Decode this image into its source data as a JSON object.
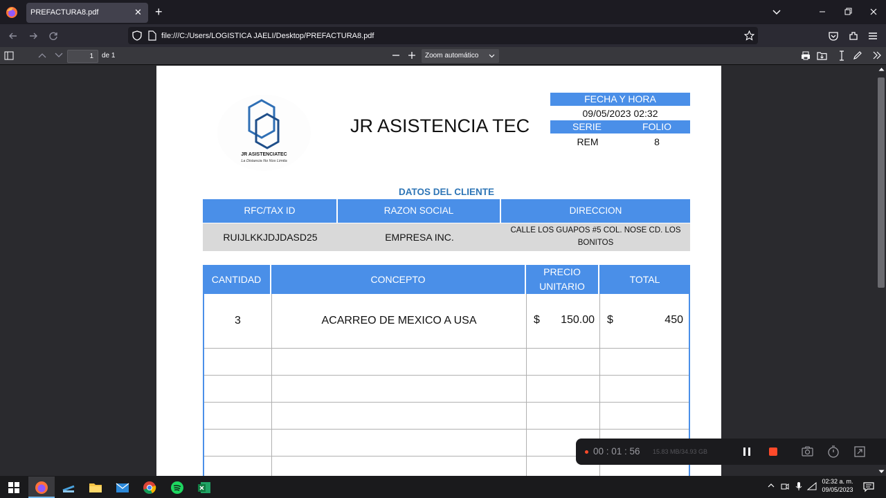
{
  "browser": {
    "tab_title": "PREFACTURA8.pdf",
    "url": "file:///C:/Users/LOGISTICA JAELI/Desktop/PREFACTURA8.pdf"
  },
  "pdf_toolbar": {
    "page_current": "1",
    "page_total": "de 1",
    "zoom": "Zoom automático"
  },
  "document": {
    "company_name": "JR ASISTENCIA TEC",
    "logo_name": "JR ASISTENCIATEC",
    "logo_tagline": "La Distancia No Nos Limita",
    "info": {
      "fecha_label": "FECHA Y HORA",
      "fecha_value": "09/05/2023 02:32",
      "serie_label": "SERIE",
      "folio_label": "FOLIO",
      "serie_value": "REM",
      "folio_value": "8"
    },
    "client": {
      "section_title": "DATOS DEL CLIENTE",
      "headers": [
        "RFC/TAX ID",
        "RAZON SOCIAL",
        "DIRECCION"
      ],
      "values": [
        "RUIJLKKJDJDASD25",
        "EMPRESA INC.",
        "CALLE LOS GUAPOS #5 COL. NOSE CD. LOS BONITOS"
      ]
    },
    "items": {
      "headers": [
        "CANTIDAD",
        "CONCEPTO",
        "PRECIO UNITARIO",
        "TOTAL"
      ],
      "rows": [
        {
          "cantidad": "3",
          "concepto": "ACARREO DE MEXICO A USA",
          "currency": "$",
          "precio": "150.00",
          "total": "450"
        }
      ]
    }
  },
  "recorder": {
    "time": "00 : 01 : 56",
    "storage": "15.83 MB/34.93 GB"
  },
  "taskbar": {
    "time": "02:32 a. m.",
    "date": "09/05/2023"
  },
  "colors": {
    "table_header": "#4a8fe8",
    "section_title": "#2e75b6",
    "record_red": "#ff4a2a"
  }
}
